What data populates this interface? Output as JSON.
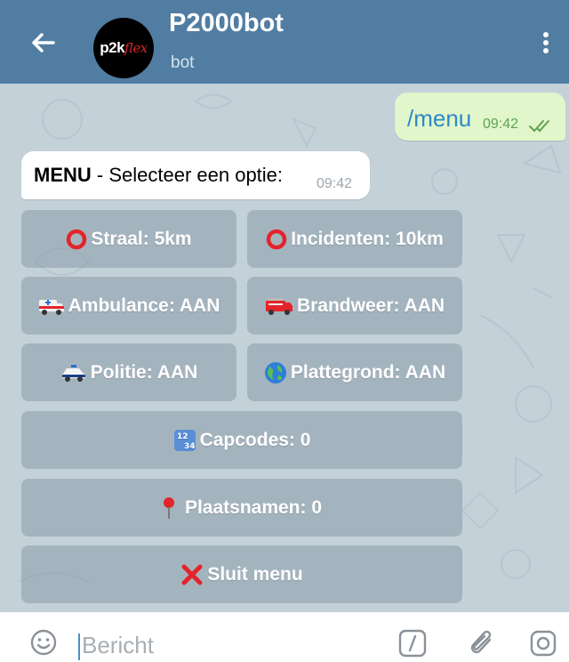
{
  "header": {
    "title": "P2000bot",
    "subtitle": "bot",
    "avatar_text_1": "p2k",
    "avatar_text_2": "flex",
    "background": "#517da2"
  },
  "messages": {
    "outgoing": {
      "text": "/menu",
      "time": "09:42",
      "status": "read"
    },
    "incoming": {
      "text_bold": "MENU",
      "text_rest": " - Selecteer een optie:",
      "time": "09:42"
    }
  },
  "keyboard": {
    "straal": "Straal: 5km",
    "incidenten": "Incidenten: 10km",
    "ambulance": "Ambulance: AAN",
    "brandweer": "Brandweer: AAN",
    "politie": "Politie: AAN",
    "plattegrond": "Plattegrond: AAN",
    "capcodes": "Capcodes: 0",
    "plaatsnamen": "Plaatsnamen: 0",
    "sluit": "Sluit menu",
    "icons": {
      "straal": "hollow-red-circle-icon",
      "incidenten": "hollow-red-circle-icon",
      "ambulance": "ambulance-icon",
      "brandweer": "fire-engine-icon",
      "politie": "police-car-icon",
      "plattegrond": "globe-icon",
      "capcodes": "input-numbers-icon",
      "plaatsnamen": "round-pushpin-icon",
      "sluit": "cross-mark-icon"
    }
  },
  "input": {
    "placeholder": "Bericht"
  },
  "colors": {
    "accent": "#517da2",
    "outgoing_bubble": "#e1f6cb",
    "link": "#2f8ac4",
    "red": "#e3242b"
  }
}
